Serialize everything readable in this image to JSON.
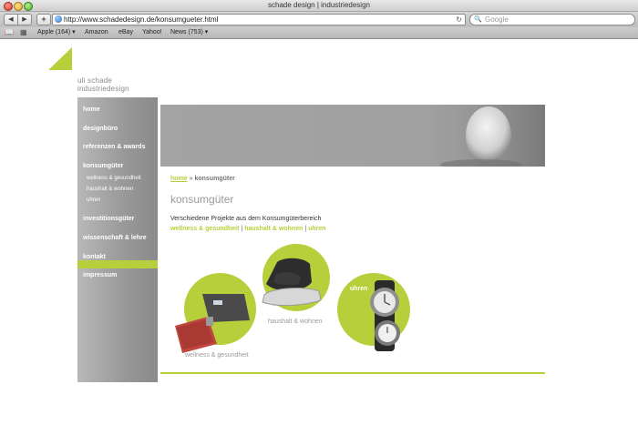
{
  "browser": {
    "window_title": "schade design | industriedesign",
    "url": "http://www.schadedesign.de/konsumgueter.html",
    "search_placeholder": "Google",
    "back_glyph": "◀",
    "forward_glyph": "▶",
    "add_glyph": "+",
    "reload_glyph": "↻",
    "search_glyph": "🔍",
    "bookmarks": [
      {
        "label": "Apple (164) ▾"
      },
      {
        "label": "Amazon"
      },
      {
        "label": "eBay"
      },
      {
        "label": "Yahoo!"
      },
      {
        "label": "News (753) ▾"
      }
    ]
  },
  "logo": {
    "line1": "uli schade",
    "line2": "industriedesign"
  },
  "sidebar": {
    "items": [
      {
        "label": "home"
      },
      {
        "label": "designbüro"
      },
      {
        "label": "referenzen & awards"
      },
      {
        "label": "konsumgüter"
      },
      {
        "label": "investitionsgüter"
      },
      {
        "label": "wissenschaft & lehre"
      },
      {
        "label": "kontakt"
      },
      {
        "label": "impressum"
      }
    ],
    "subitems": [
      {
        "label": "wellness & gesundheit"
      },
      {
        "label": "haushalt & wohnen"
      },
      {
        "label": "uhren"
      }
    ]
  },
  "breadcrumb": {
    "home": "home",
    "separator": "»",
    "current": "konsumgüter"
  },
  "main": {
    "title": "konsumgüter",
    "intro": "Verschiedene Projekte aus dem Konsumgüterbereich",
    "categories": [
      {
        "label": "wellness & gesundheit"
      },
      {
        "label": "haushalt & wohnen"
      },
      {
        "label": "uhren"
      }
    ],
    "category_separator": "|",
    "circle_labels": {
      "wellness": "wellness & gesundheit",
      "haushalt": "haushalt & wohnen",
      "uhren": "uhren"
    }
  },
  "colors": {
    "accent": "#b7cf3a",
    "sidebar": "#9a9a9a",
    "title_gray": "#9a9a9a"
  }
}
